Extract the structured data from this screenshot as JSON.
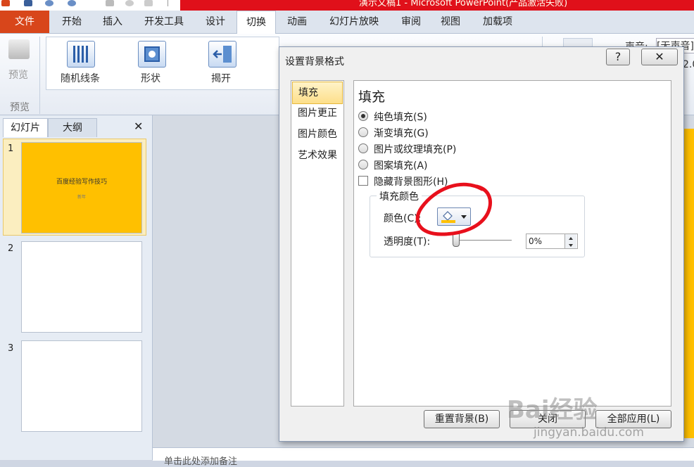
{
  "app_title": "演示文稿1 - Microsoft PowerPoint(产品激活失败)",
  "tabs": [
    "文件",
    "开始",
    "插入",
    "开发工具",
    "设计",
    "切换",
    "动画",
    "幻灯片放映",
    "审阅",
    "视图",
    "加载项"
  ],
  "active_tab": "切换",
  "ribbon": {
    "preview_button": "预览",
    "preview_group": "预览",
    "transitions": [
      "随机线条",
      "形状",
      "揭开"
    ],
    "sound_label": "声音:",
    "sound_value": "[无声音]",
    "duration_fragment": "2.0"
  },
  "left_pane": {
    "tab_slides": "幻灯片",
    "tab_outline": "大纲",
    "close": "✕",
    "slides": [
      {
        "number": "1",
        "title": "百度经验写作技巧",
        "subtitle": "新年"
      },
      {
        "number": "2"
      },
      {
        "number": "3"
      }
    ]
  },
  "notes_placeholder": "单击此处添加备注",
  "dialog": {
    "title": "设置背景格式",
    "help": "?",
    "close": "✕",
    "nav": [
      "填充",
      "图片更正",
      "图片颜色",
      "艺术效果"
    ],
    "nav_selected": "填充",
    "heading": "填充",
    "options": [
      {
        "label": "纯色填充(S)",
        "selected": true
      },
      {
        "label": "渐变填充(G)",
        "selected": false
      },
      {
        "label": "图片或纹理填充(P)",
        "selected": false
      },
      {
        "label": "图案填充(A)",
        "selected": false
      }
    ],
    "hide_bg_graphics": "隐藏背景图形(H)",
    "fill_color_group": "填充颜色",
    "color_label": "颜色(C):",
    "transparency_label": "透明度(T):",
    "transparency_value": "0%",
    "transparency_level": 0,
    "buttons": {
      "reset": "重置背景(B)",
      "close": "关闭",
      "apply_all": "全部应用(L)"
    }
  },
  "watermark": {
    "brand": "Bai经验",
    "url": "jingyan.baidu.com"
  },
  "colors": {
    "file_tab": "#d8461b",
    "slide_fill": "#ffc000",
    "annotation": "#e8101c",
    "title_bar": "#e0101a"
  }
}
